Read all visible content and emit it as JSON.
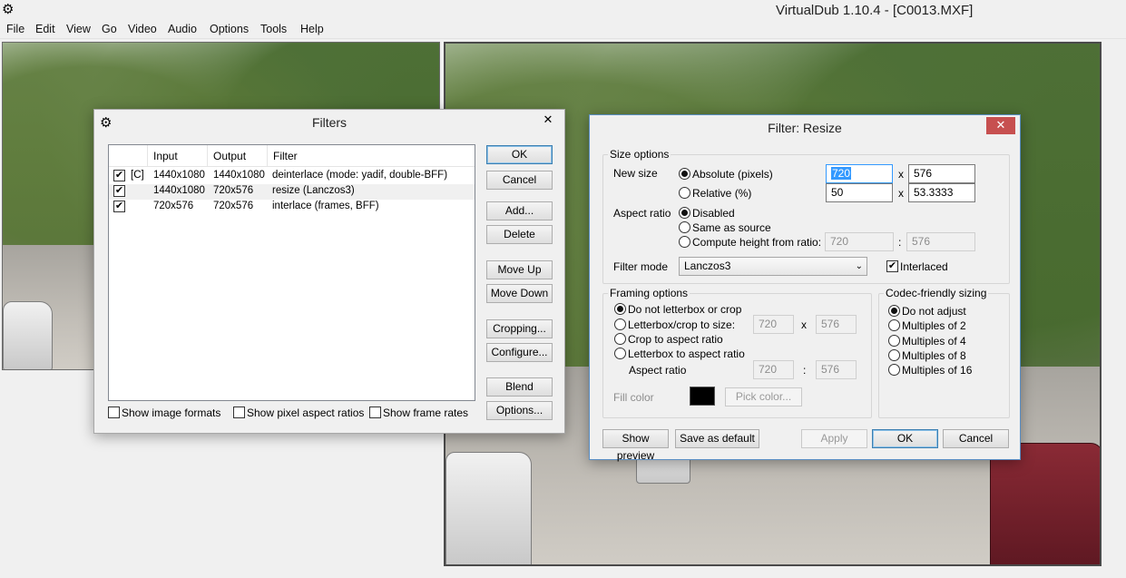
{
  "window": {
    "title": "VirtualDub 1.10.4 - [C0013.MXF]",
    "app_icon": "gear-icon"
  },
  "menu": [
    "File",
    "Edit",
    "View",
    "Go",
    "Video",
    "Audio",
    "Options",
    "Tools",
    "Help"
  ],
  "filters_dialog": {
    "title": "Filters",
    "close": "✕",
    "columns": [
      "Input",
      "Output",
      "Filter"
    ],
    "rows": [
      {
        "checked": true,
        "flag": "[C]",
        "input": "1440x1080",
        "output": "1440x1080",
        "filter": "deinterlace (mode: yadif, double-BFF)"
      },
      {
        "checked": true,
        "flag": "",
        "input": "1440x1080",
        "output": "720x576",
        "filter": "resize (Lanczos3)"
      },
      {
        "checked": true,
        "flag": "",
        "input": "720x576",
        "output": "720x576",
        "filter": "interlace (frames, BFF)"
      }
    ],
    "buttons": {
      "ok": "OK",
      "cancel": "Cancel",
      "add": "Add...",
      "delete": "Delete",
      "move_up": "Move Up",
      "move_down": "Move Down",
      "cropping": "Cropping...",
      "configure": "Configure...",
      "blend": "Blend",
      "options": "Options..."
    },
    "checkboxes": {
      "image_formats": "Show image formats",
      "pixel_aspect": "Show pixel aspect ratios",
      "frame_rates": "Show frame rates"
    }
  },
  "resize_dialog": {
    "title": "Filter: Resize",
    "close": "✕",
    "size_options": {
      "group_title": "Size options",
      "new_size_label": "New size",
      "absolute_label": "Absolute (pixels)",
      "relative_label": "Relative (%)",
      "abs_width": "720",
      "abs_height": "576",
      "rel_width": "50",
      "rel_height": "53.3333",
      "x_sep": "x",
      "aspect_ratio_label": "Aspect ratio",
      "ar_disabled": "Disabled",
      "ar_same_source": "Same as source",
      "ar_compute": "Compute height from ratio:",
      "ar_w": "720",
      "ar_h": "576",
      "colon": ":",
      "filter_mode_label": "Filter mode",
      "filter_mode_value": "Lanczos3",
      "interlaced_label": "Interlaced",
      "interlaced_checked": true
    },
    "framing": {
      "group_title": "Framing options",
      "opt_no_letterbox": "Do not letterbox or crop",
      "opt_letterbox_size": "Letterbox/crop to size:",
      "size_w": "720",
      "size_h": "576",
      "x_sep": "x",
      "opt_crop_aspect": "Crop to aspect ratio",
      "opt_letterbox_aspect": "Letterbox to aspect ratio",
      "aspect_ratio_label": "Aspect ratio",
      "aspect_w": "720",
      "aspect_h": "576",
      "colon": ":",
      "fill_color_label": "Fill color",
      "fill_color": "#000000",
      "pick_color": "Pick color..."
    },
    "codec": {
      "group_title": "Codec-friendly sizing",
      "options": [
        "Do not adjust",
        "Multiples of 2",
        "Multiples of 4",
        "Multiples of 8",
        "Multiples of 16"
      ]
    },
    "buttons": {
      "show_preview": "Show preview",
      "save_default": "Save as default",
      "apply": "Apply",
      "ok": "OK",
      "cancel": "Cancel"
    },
    "accent_close": "#c75050",
    "selection_color": "#3399ff"
  }
}
